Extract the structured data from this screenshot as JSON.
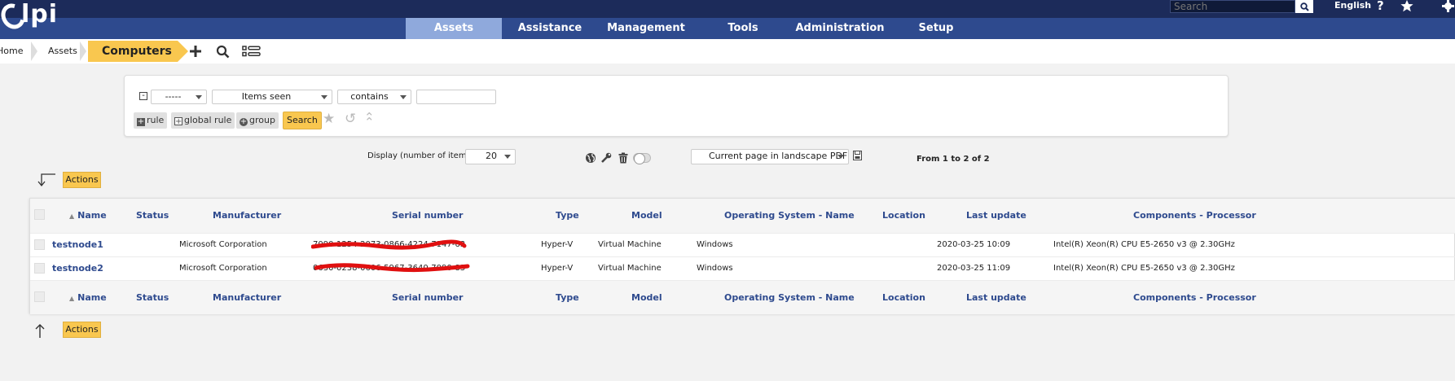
{
  "logo": {
    "text": "lpi"
  },
  "topbar": {
    "search_placeholder": "Search",
    "language": "English",
    "help_icon": "?",
    "icons": [
      "search-icon",
      "help-icon",
      "star-icon",
      "gear-icon"
    ]
  },
  "nav": {
    "items": [
      {
        "label": "Assets",
        "active": true
      },
      {
        "label": "Assistance"
      },
      {
        "label": "Management"
      },
      {
        "label": "Tools"
      },
      {
        "label": "Administration"
      },
      {
        "label": "Setup"
      }
    ]
  },
  "breadcrumb": {
    "home": "Home",
    "assets": "Assets",
    "current": "Computers"
  },
  "search_panel": {
    "field_select": "-----",
    "criteria_select": "Items seen",
    "operator_select": "contains",
    "value_input": "",
    "rule_btn": "rule",
    "global_rule_btn": "global rule",
    "group_btn": "group",
    "search_btn": "Search"
  },
  "display": {
    "label": "Display (number of items)",
    "count": "20",
    "export_select": "Current page in landscape PDF",
    "pager": "From 1 to 2 of 2"
  },
  "actions_label": "Actions",
  "table": {
    "columns": [
      "Name",
      "Status",
      "Manufacturer",
      "Serial number",
      "Type",
      "Model",
      "Operating System - Name",
      "Location",
      "Last update",
      "Components - Processor"
    ],
    "rows": [
      {
        "name": "testnode1",
        "status": "",
        "manufacturer": "Microsoft Corporation",
        "serial": "7090-1254-2073-0866-4224-7147-63",
        "type": "Hyper-V",
        "model": "Virtual Machine",
        "os": "Windows",
        "location": "",
        "last_update": "2020-03-25 10:09",
        "processor": "Intel(R) Xeon(R) CPU E5-2650 v3 @ 2.30GHz"
      },
      {
        "name": "testnode2",
        "status": "",
        "manufacturer": "Microsoft Corporation",
        "serial": "0630-0238-0606-5967-3640-7090-83",
        "type": "Hyper-V",
        "model": "Virtual Machine",
        "os": "Windows",
        "location": "",
        "last_update": "2020-03-25 11:09",
        "processor": "Intel(R) Xeon(R) CPU E5-2650 v3 @ 2.30GHz"
      }
    ]
  }
}
